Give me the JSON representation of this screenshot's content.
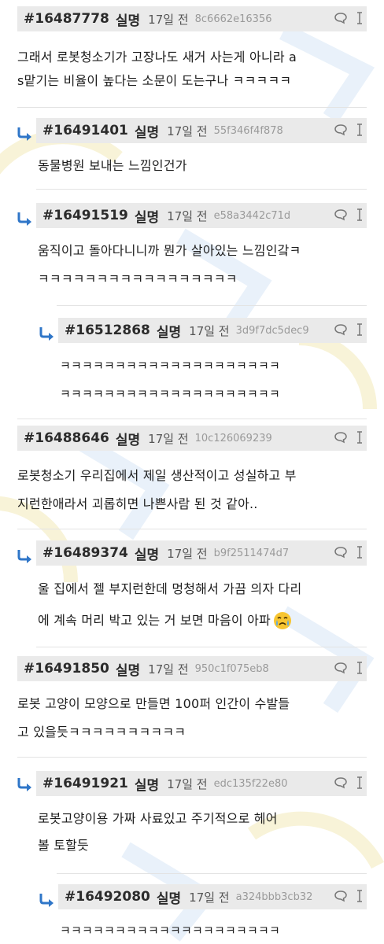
{
  "comments": [
    {
      "num": "#16487778",
      "anon": "실명",
      "time": "17일 전",
      "hash": "8c6662e16356",
      "lines": [
        "그래서 로봇청소기가 고장나도 새거 사는게 아니라 a",
        "s맡기는 비율이 높다는 소문이 도는구나 ㅋㅋㅋㅋㅋ"
      ],
      "emoji": false
    },
    {
      "num": "#16491401",
      "anon": "실명",
      "time": "17일 전",
      "hash": "55f346f4f878",
      "lines": [
        "동물병원 보내는 느낌인건가"
      ],
      "emoji": false
    },
    {
      "num": "#16491519",
      "anon": "실명",
      "time": "17일 전",
      "hash": "e58a3442c71d",
      "lines": [
        "움직이고 돌아다니니까 뭔가 살아있는 느낌인갘ㅋ",
        "ㅋㅋㅋㅋㅋㅋㅋㅋㅋㅋㅋㅋㅋㅋㅋㅋㅋ"
      ],
      "emoji": false
    },
    {
      "num": "#16512868",
      "anon": "실명",
      "time": "17일 전",
      "hash": "3d9f7dc5dec9",
      "lines": [
        "ㅋㅋㅋㅋㅋㅋㅋㅋㅋㅋㅋㅋㅋㅋㅋㅋㅋㅋㅋㅋ",
        "ㅋㅋㅋㅋㅋㅋㅋㅋㅋㅋㅋㅋㅋㅋㅋㅋㅋㅋㅋㅋ"
      ],
      "emoji": false
    },
    {
      "num": "#16488646",
      "anon": "실명",
      "time": "17일 전",
      "hash": "10c126069239",
      "lines": [
        "로봇청소기 우리집에서 제일 생산적이고 성실하고 부",
        "지런한애라서 괴롭히면 나쁜사람 된 것 같아.."
      ],
      "emoji": false
    },
    {
      "num": "#16489374",
      "anon": "실명",
      "time": "17일 전",
      "hash": "b9f2511474d7",
      "lines": [
        "울 집에서 젤 부지런한데 멍청해서 가끔 의자 다리",
        "에 계속 머리 박고 있는 거 보면 마음이 아파"
      ],
      "emoji": true
    },
    {
      "num": "#16491850",
      "anon": "실명",
      "time": "17일 전",
      "hash": "950c1f075eb8",
      "lines": [
        "로봇 고양이 모양으로 만들면 100퍼 인간이 수발들",
        "고 있을듯ㅋㅋㅋㅋㅋㅋㅋㅋㅋㅋ"
      ],
      "emoji": false
    },
    {
      "num": "#16491921",
      "anon": "실명",
      "time": "17일 전",
      "hash": "edc135f22e80",
      "lines": [
        "로봇고양이용 가짜 사료있고 주기적으로 헤어",
        "볼 토할듯"
      ],
      "emoji": false
    },
    {
      "num": "#16492080",
      "anon": "실명",
      "time": "17일 전",
      "hash": "a324bbb3cb32",
      "lines": [
        "ㅋㅋㅋㅋㅋㅋㅋㅋㅋㅋㅋㅋㅋㅋㅋㅋㅋㅋㅋㅋ"
      ],
      "emoji": false
    }
  ],
  "icons": {
    "reply": "reply-arrow-icon",
    "chat": "speech-bubble-icon",
    "report": "report-bar-icon",
    "emoji": "crying-face-emoji"
  },
  "colors": {
    "header_bg": "#eaeaea",
    "reply_arrow": "#2f76c8",
    "text": "#1c1c1c",
    "hash": "#9a9a9a"
  }
}
